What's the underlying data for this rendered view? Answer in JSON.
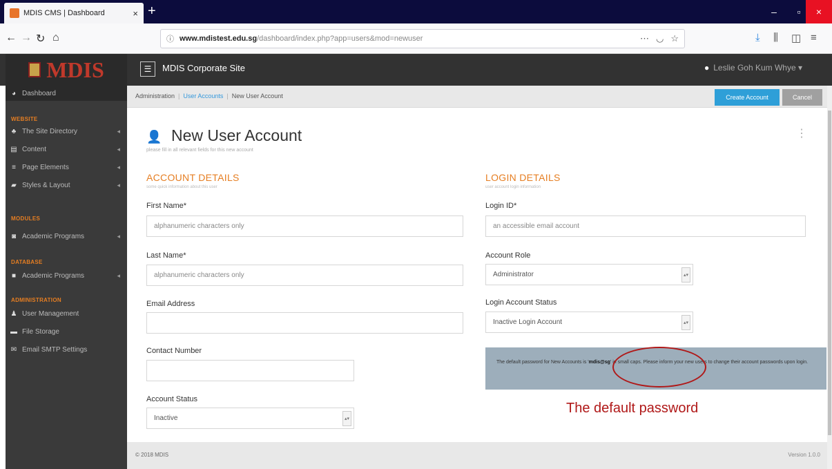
{
  "browser": {
    "tab_title": "MDIS CMS | Dashboard",
    "tab_close": "×",
    "new_tab": "+",
    "url_domain": "www.mdistest.edu.sg",
    "url_path": "/dashboard/index.php?app=users&mod=newuser",
    "window_controls": {
      "minimize": "–",
      "maximize": "▫",
      "close": "×"
    },
    "icons": [
      "back-icon",
      "forward-icon",
      "reload-icon",
      "home-icon",
      "info-icon",
      "more-icon",
      "pocket-icon",
      "bookmark-star-icon",
      "download-icon",
      "library-icon",
      "sidebar-icon",
      "menu-icon"
    ]
  },
  "header": {
    "logo_text": "MDIS",
    "site_name": "MDIS Corporate Site",
    "user_name": "Leslie Goh Kum Whye"
  },
  "sidebar": {
    "dashboard": "Dashboard",
    "sections": {
      "website": "WEBSITE",
      "modules": "MODULES",
      "database": "DATABASE",
      "administration": "ADMINISTRATION"
    },
    "items": {
      "site_directory": "The Site Directory",
      "content": "Content",
      "page_elements": "Page Elements",
      "styles_layout": "Styles & Layout",
      "modules_academic": "Academic Programs",
      "database_academic": "Academic Programs",
      "user_management": "User Management",
      "file_storage": "File Storage",
      "email_smtp": "Email SMTP Settings"
    }
  },
  "breadcrumb": {
    "administration": "Administration",
    "user_accounts": "User Accounts",
    "current": "New User Account"
  },
  "actions": {
    "create": "Create Account",
    "cancel": "Cancel"
  },
  "page": {
    "title": "New User Account",
    "subtitle": "please fill in all relevant fields for this new account"
  },
  "account_details": {
    "title": "ACCOUNT DETAILS",
    "subtitle": "some quick information about this user",
    "first_name_label": "First Name*",
    "first_name_placeholder": "alphanumeric characters only",
    "last_name_label": "Last Name*",
    "last_name_placeholder": "alphanumeric characters only",
    "email_label": "Email Address",
    "contact_label": "Contact Number",
    "status_label": "Account Status",
    "status_value": "Inactive"
  },
  "login_details": {
    "title": "LOGIN DETAILS",
    "subtitle": "user account login information",
    "login_id_label": "Login ID*",
    "login_id_placeholder": "an accessible email account",
    "role_label": "Account Role",
    "role_value": "Administrator",
    "login_status_label": "Login Account Status",
    "login_status_value": "Inactive Login Account",
    "info_pre": "The default password for New Accounts is '",
    "info_password": "mdis@sg",
    "info_post": "' in small caps. Please inform your new users to change their account passwords upon login."
  },
  "annotation": "The default password",
  "footer": {
    "copyright": "© 2018 MDIS",
    "version": "Version 1.0.0"
  }
}
